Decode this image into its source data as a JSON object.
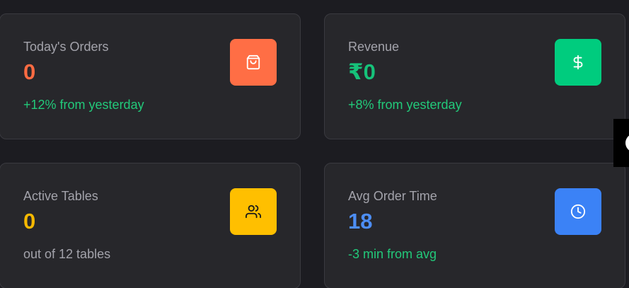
{
  "cards": [
    {
      "label": "Today's Orders",
      "value": "0",
      "value_color": "#ff6b42",
      "sub": "+12% from yesterday",
      "sub_tone": "positive",
      "icon": "shopping-bag-icon",
      "icon_bg": "#ff6e45"
    },
    {
      "label": "Revenue",
      "value": "₹0",
      "value_color": "#16c27a",
      "sub": "+8% from yesterday",
      "sub_tone": "positive",
      "icon": "dollar-icon",
      "icon_bg": "#00cc7e"
    },
    {
      "label": "Active Tables",
      "value": "0",
      "value_color": "#f5b800",
      "sub": "out of 12 tables",
      "sub_tone": "neutral",
      "icon": "users-icon",
      "icon_bg": "#ffbf00"
    },
    {
      "label": "Avg Order Time",
      "value": "18",
      "value_color": "#4d8ef5",
      "sub": "-3 min from avg",
      "sub_tone": "positive",
      "icon": "clock-icon",
      "icon_bg": "#3b82f6"
    }
  ]
}
